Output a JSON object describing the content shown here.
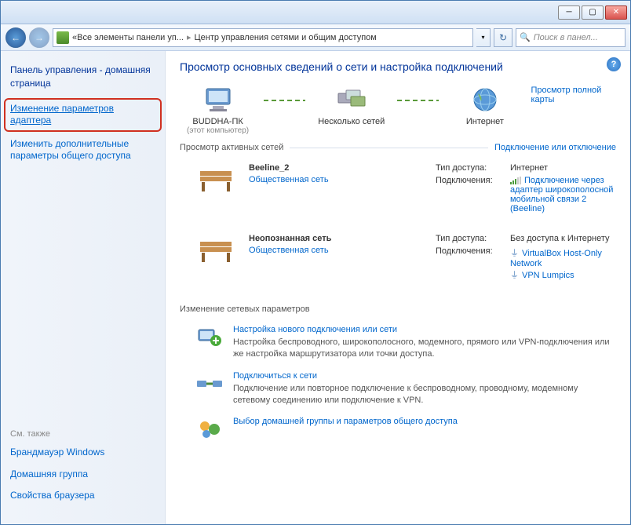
{
  "breadcrumb": {
    "seg1": "Все элементы панели уп...",
    "seg2": "Центр управления сетями и общим доступом"
  },
  "search": {
    "placeholder": "Поиск в панел..."
  },
  "sidebar": {
    "home": "Панель управления - домашняя страница",
    "link_adapter": "Изменение параметров адаптера",
    "link_sharing": "Изменить дополнительные параметры общего доступа",
    "also_h": "См. также",
    "also_firewall": "Брандмауэр Windows",
    "also_homegroup": "Домашняя группа",
    "also_browser": "Свойства браузера"
  },
  "main": {
    "title": "Просмотр основных сведений о сети и настройка подключений",
    "map_full": "Просмотр полной карты",
    "map_node1": "BUDDHA-ПК",
    "map_node1_sub": "(этот компьютер)",
    "map_node2": "Несколько сетей",
    "map_node3": "Интернет",
    "active_h": "Просмотр активных сетей",
    "active_lnk": "Подключение или отключение",
    "net1": {
      "name": "Beeline_2",
      "type": "Общественная сеть",
      "access_lbl": "Тип доступа:",
      "access_val": "Интернет",
      "conn_lbl": "Подключения:",
      "conn_val": "Подключение через адаптер широкополосной мобильной связи 2 (Beeline)"
    },
    "net2": {
      "name": "Неопознанная сеть",
      "type": "Общественная сеть",
      "access_lbl": "Тип доступа:",
      "access_val": "Без доступа к Интернету",
      "conn_lbl": "Подключения:",
      "conn_val1": "VirtualBox Host-Only Network",
      "conn_val2": "VPN Lumpics"
    },
    "settings_h": "Изменение сетевых параметров",
    "task1": {
      "t": "Настройка нового подключения или сети",
      "d": "Настройка беспроводного, широкополосного, модемного, прямого или VPN-подключения или же настройка маршрутизатора или точки доступа."
    },
    "task2": {
      "t": "Подключиться к сети",
      "d": "Подключение или повторное подключение к беспроводному, проводному, модемному сетевому соединению или подключение к VPN."
    },
    "task3": {
      "t": "Выбор домашней группы и параметров общего доступа"
    }
  }
}
